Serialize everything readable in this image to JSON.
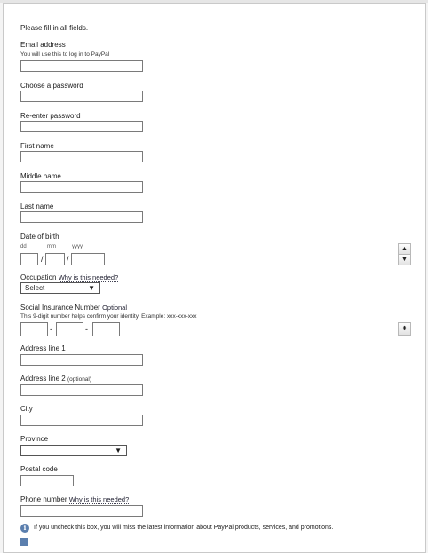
{
  "form": {
    "intro": "Please fill in all fields.",
    "email": {
      "label": "Email address",
      "hint": "You will use this to log in to PayPal",
      "value": ""
    },
    "password": {
      "label": "Choose a password",
      "value": ""
    },
    "password_confirm": {
      "label": "Re-enter password",
      "value": ""
    },
    "first_name": {
      "label": "First name",
      "value": ""
    },
    "middle_name": {
      "label": "Middle name",
      "value": ""
    },
    "last_name": {
      "label": "Last name",
      "value": ""
    },
    "dob": {
      "label": "Date of birth",
      "dd": "dd",
      "mm": "mm",
      "yyyy": "yyyy",
      "sep": "/"
    },
    "occupation": {
      "label": "Occupation",
      "help": "Why is this needed?",
      "selected": "Select"
    },
    "sin": {
      "label": "Social Insurance Number",
      "optional": "Optional",
      "hint": "This 9-digit number helps confirm your identity. Example: xxx-xxx-xxx",
      "sep": "-"
    },
    "address1": {
      "label": "Address line 1",
      "value": ""
    },
    "address2": {
      "label": "Address line 2",
      "optional": "(optional)",
      "value": ""
    },
    "city": {
      "label": "City",
      "value": ""
    },
    "province": {
      "label": "Province",
      "selected": ""
    },
    "postal": {
      "label": "Postal code",
      "value": ""
    },
    "phone": {
      "label": "Phone number",
      "help": "Why is this needed?",
      "value": ""
    },
    "newsletter": {
      "info": "If you uncheck this box, you will miss the latest information about PayPal products, services, and promotions."
    }
  },
  "icons": {
    "dropdown": "▼",
    "spin_up": "▲",
    "spin_down": "▼",
    "spin_both": "⬍",
    "info": "i"
  },
  "colors": {
    "info_blue": "#5b7fae",
    "field_border": "#7a7a7a"
  }
}
